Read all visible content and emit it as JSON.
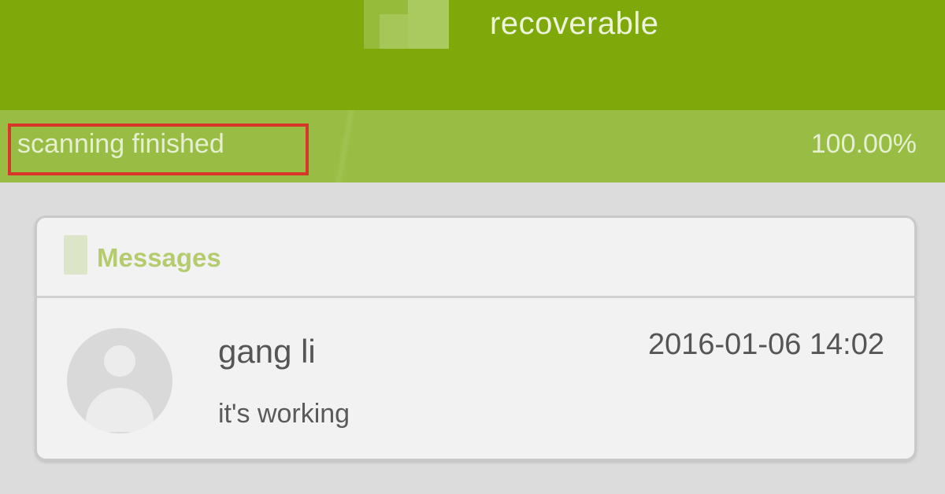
{
  "header": {
    "title": "recoverable"
  },
  "status": {
    "text": "scanning finished",
    "percent_label": "100.00%",
    "progress": 1.0
  },
  "messages_card": {
    "title": "Messages",
    "items": [
      {
        "sender": "gang li",
        "timestamp": "2016-01-06 14:02",
        "preview": "it's working"
      }
    ]
  },
  "colors": {
    "header_bg": "#7fa90b",
    "status_bg": "#99bd44",
    "highlight_border": "#d9362b",
    "card_title": "#b5cc6e"
  }
}
